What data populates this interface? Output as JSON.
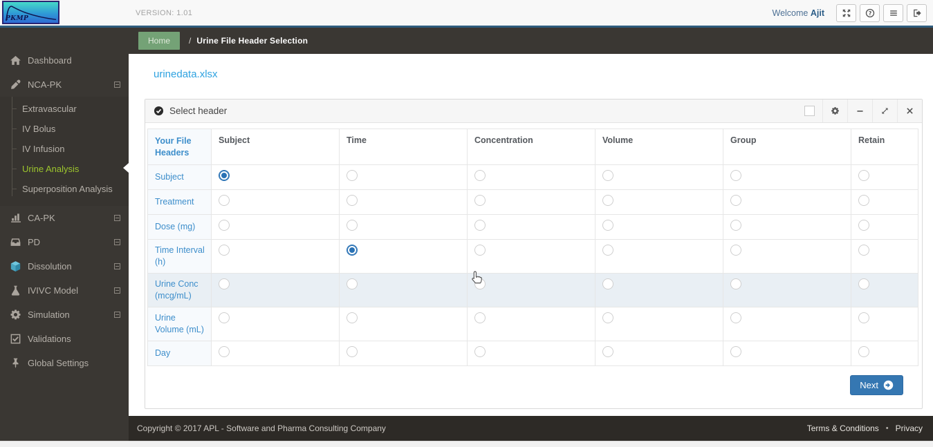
{
  "topbar": {
    "logo_text": "PKMP",
    "version": "VERSION: 1.01",
    "welcome_prefix": "Welcome",
    "username": "Ajit",
    "icon_names": [
      "fullscreen-icon",
      "help-icon",
      "menu-icon",
      "logout-icon"
    ]
  },
  "sidebar": {
    "items": [
      {
        "label": "Dashboard",
        "icon": "home-icon",
        "expandable": false
      },
      {
        "label": "NCA-PK",
        "icon": "dropper-icon",
        "expandable": true,
        "expanded": true
      },
      {
        "label": "CA-PK",
        "icon": "bar-chart-icon",
        "expandable": true
      },
      {
        "label": "PD",
        "icon": "inbox-icon",
        "expandable": true
      },
      {
        "label": "Dissolution",
        "icon": "cube-icon",
        "expandable": true
      },
      {
        "label": "IVIVC Model",
        "icon": "flask-icon",
        "expandable": true
      },
      {
        "label": "Simulation",
        "icon": "gear-icon",
        "expandable": true
      },
      {
        "label": "Validations",
        "icon": "check-square-icon",
        "expandable": false
      },
      {
        "label": "Global Settings",
        "icon": "pin-icon",
        "expandable": false
      }
    ],
    "nca_pk_children": [
      {
        "label": "Extravascular",
        "active": false
      },
      {
        "label": "IV Bolus",
        "active": false
      },
      {
        "label": "IV Infusion",
        "active": false
      },
      {
        "label": "Urine Analysis",
        "active": true
      },
      {
        "label": "Superposition Analysis",
        "active": false
      }
    ]
  },
  "breadcrumb": {
    "home": "Home",
    "separator": "/",
    "current": "Urine File Header Selection"
  },
  "content": {
    "filename": "urinedata.xlsx",
    "panel": {
      "title": "Select header",
      "control_icons": [
        "checkbox",
        "settings-icon",
        "collapse-icon",
        "expand-icon",
        "close-icon"
      ],
      "table": {
        "corner_header": "Your File Headers",
        "columns": [
          "Subject",
          "Time",
          "Concentration",
          "Volume",
          "Group",
          "Retain"
        ],
        "rows": [
          {
            "label": "Subject",
            "selected_column": "Subject",
            "highlighted": false
          },
          {
            "label": "Treatment",
            "selected_column": null,
            "highlighted": false
          },
          {
            "label": "Dose (mg)",
            "selected_column": null,
            "highlighted": false
          },
          {
            "label": "Time Interval (h)",
            "selected_column": "Time",
            "highlighted": false
          },
          {
            "label": "Urine Conc (mcg/mL)",
            "selected_column": null,
            "highlighted": true
          },
          {
            "label": "Urine Volume (mL)",
            "selected_column": null,
            "highlighted": false
          },
          {
            "label": "Day",
            "selected_column": null,
            "highlighted": false
          }
        ]
      },
      "next_button_label": "Next"
    }
  },
  "footer": {
    "copyright": "Copyright © 2017 APL - Software and Pharma Consulting Company",
    "links": [
      "Terms & Conditions",
      "Privacy"
    ],
    "separator": "•"
  },
  "colors": {
    "sidebar_bg": "#3a3733",
    "active_item_green": "#9dc62d",
    "link_blue": "#2ea2e0",
    "row_label_blue": "#3d8ecb",
    "next_button_blue": "#3577b2",
    "home_button_green": "#74a276",
    "footer_bg": "#2d2a26",
    "radio_selected_blue": "#2a72b5",
    "highlight_row_bg": "#e9eff4"
  }
}
